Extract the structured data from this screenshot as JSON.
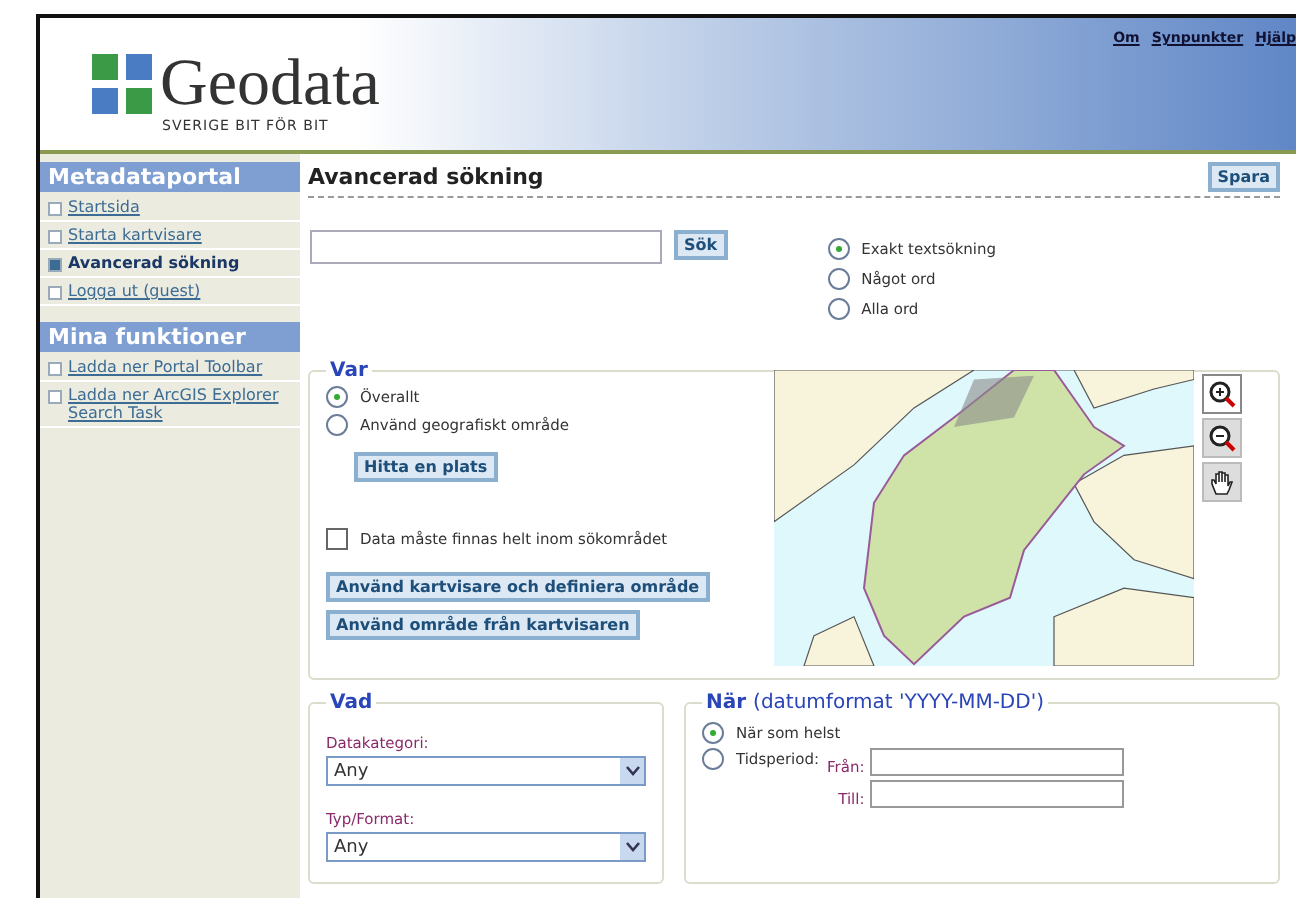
{
  "header": {
    "logo": {
      "name": "Geodata",
      "tagline": "SVERIGE BIT FÖR BIT"
    },
    "links": [
      "Om",
      "Synpunkter",
      "Hjälp"
    ]
  },
  "sidebar": {
    "sections": [
      {
        "title": "Metadataportal",
        "items": [
          {
            "label": "Startsida",
            "selected": false
          },
          {
            "label": "Starta kartvisare",
            "selected": false
          },
          {
            "label": "Avancerad sökning",
            "selected": true
          },
          {
            "label": "Logga ut (guest)",
            "selected": false
          }
        ]
      },
      {
        "title": "Mina funktioner",
        "items": [
          {
            "label": "Ladda ner Portal Toolbar",
            "selected": false
          },
          {
            "label": "Ladda ner ArcGIS Explorer Search Task",
            "selected": false
          }
        ]
      }
    ]
  },
  "main": {
    "title": "Avancerad sökning",
    "save_button": "Spara",
    "search": {
      "button": "Sök"
    },
    "match_options": [
      {
        "label": "Exakt textsökning",
        "selected": true
      },
      {
        "label": "Något ord",
        "selected": false
      },
      {
        "label": "Alla ord",
        "selected": false
      }
    ],
    "var": {
      "title": "Var",
      "options": [
        {
          "label": "Överallt",
          "selected": true
        },
        {
          "label": "Använd geografiskt område",
          "selected": false
        }
      ],
      "find_place_button": "Hitta en plats",
      "within": {
        "label": "Data måste finnas helt inom sökområdet",
        "checked": false
      },
      "buttons": [
        "Använd kartvisare och definiera område",
        "Använd område från kartvisaren"
      ],
      "map_tools": [
        {
          "kind": "zoom-in",
          "selected": true
        },
        {
          "kind": "zoom-out",
          "selected": false
        },
        {
          "kind": "pan",
          "selected": false
        }
      ]
    },
    "vad": {
      "title": "Vad",
      "fields": [
        {
          "label": "Datakategori:",
          "value": "Any"
        },
        {
          "label": "Typ/Format:",
          "value": "Any"
        }
      ]
    },
    "nar": {
      "title": "När",
      "hint": "(datumformat 'YYYY-MM-DD')",
      "options": [
        {
          "label": "När som helst",
          "selected": true
        },
        {
          "label": "Tidsperiod:",
          "selected": false
        }
      ],
      "from_label": "Från:",
      "to_label": "Till:"
    }
  }
}
